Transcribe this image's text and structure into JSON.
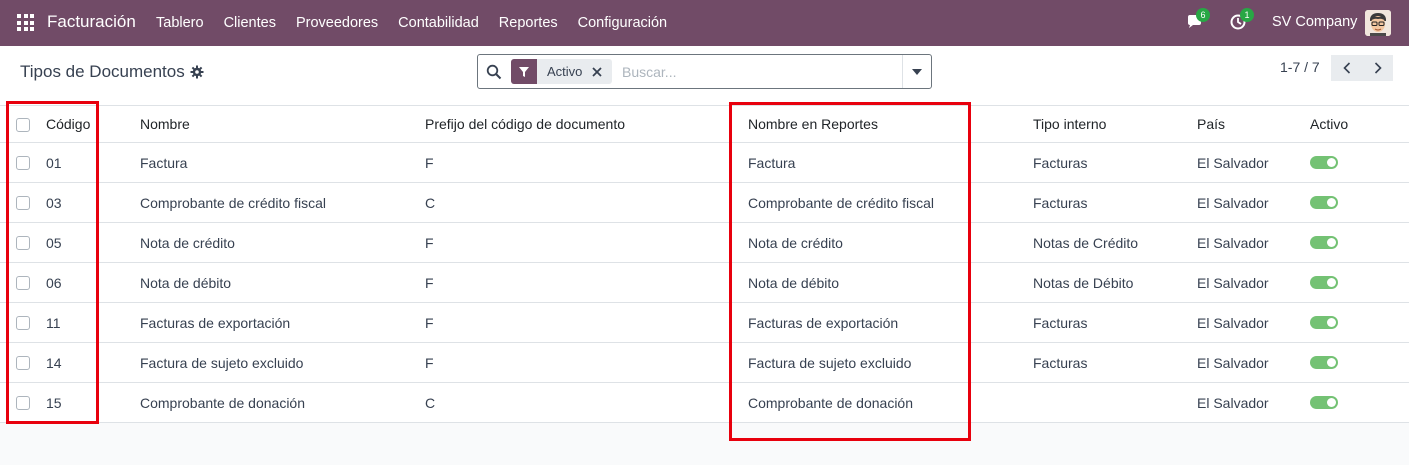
{
  "navbar": {
    "app_name": "Facturación",
    "menu": [
      "Tablero",
      "Clientes",
      "Proveedores",
      "Contabilidad",
      "Reportes",
      "Configuración"
    ],
    "messages_count": "6",
    "activities_count": "1",
    "company": "SV Company"
  },
  "control_panel": {
    "title": "Tipos de Documentos",
    "search": {
      "facet_label": "Activo",
      "placeholder": "Buscar..."
    },
    "pager": "1-7 / 7"
  },
  "table": {
    "columns": [
      "Código",
      "Nombre",
      "Prefijo del código de documento",
      "Nombre en Reportes",
      "Tipo interno",
      "País",
      "Activo"
    ],
    "rows": [
      {
        "code": "01",
        "name": "Factura",
        "prefix": "F",
        "report_name": "Factura",
        "internal_type": "Facturas",
        "country": "El Salvador",
        "active": true
      },
      {
        "code": "03",
        "name": "Comprobante de crédito fiscal",
        "prefix": "C",
        "report_name": "Comprobante de crédito fiscal",
        "internal_type": "Facturas",
        "country": "El Salvador",
        "active": true
      },
      {
        "code": "05",
        "name": "Nota de crédito",
        "prefix": "F",
        "report_name": "Nota de crédito",
        "internal_type": "Notas de Crédito",
        "country": "El Salvador",
        "active": true
      },
      {
        "code": "06",
        "name": "Nota de débito",
        "prefix": "F",
        "report_name": "Nota de débito",
        "internal_type": "Notas de Débito",
        "country": "El Salvador",
        "active": true
      },
      {
        "code": "11",
        "name": "Facturas de exportación",
        "prefix": "F",
        "report_name": "Facturas de exportación",
        "internal_type": "Facturas",
        "country": "El Salvador",
        "active": true
      },
      {
        "code": "14",
        "name": "Factura de sujeto excluido",
        "prefix": "F",
        "report_name": "Factura de sujeto excluido",
        "internal_type": "Facturas",
        "country": "El Salvador",
        "active": true
      },
      {
        "code": "15",
        "name": "Comprobante de donación",
        "prefix": "C",
        "report_name": "Comprobante de donación",
        "internal_type": "",
        "country": "El Salvador",
        "active": true
      }
    ]
  },
  "colors": {
    "navbar": "#714b67",
    "toggle_on": "#5cb85c",
    "highlight": "#e8000d",
    "badge": "#28a745"
  },
  "icons": [
    "apps-grid-icon",
    "chat-icon",
    "activity-clock-icon",
    "avatar",
    "gear-icon",
    "search-icon",
    "filter-icon",
    "close-icon",
    "caret-down-icon",
    "chevron-left-icon",
    "chevron-right-icon"
  ]
}
